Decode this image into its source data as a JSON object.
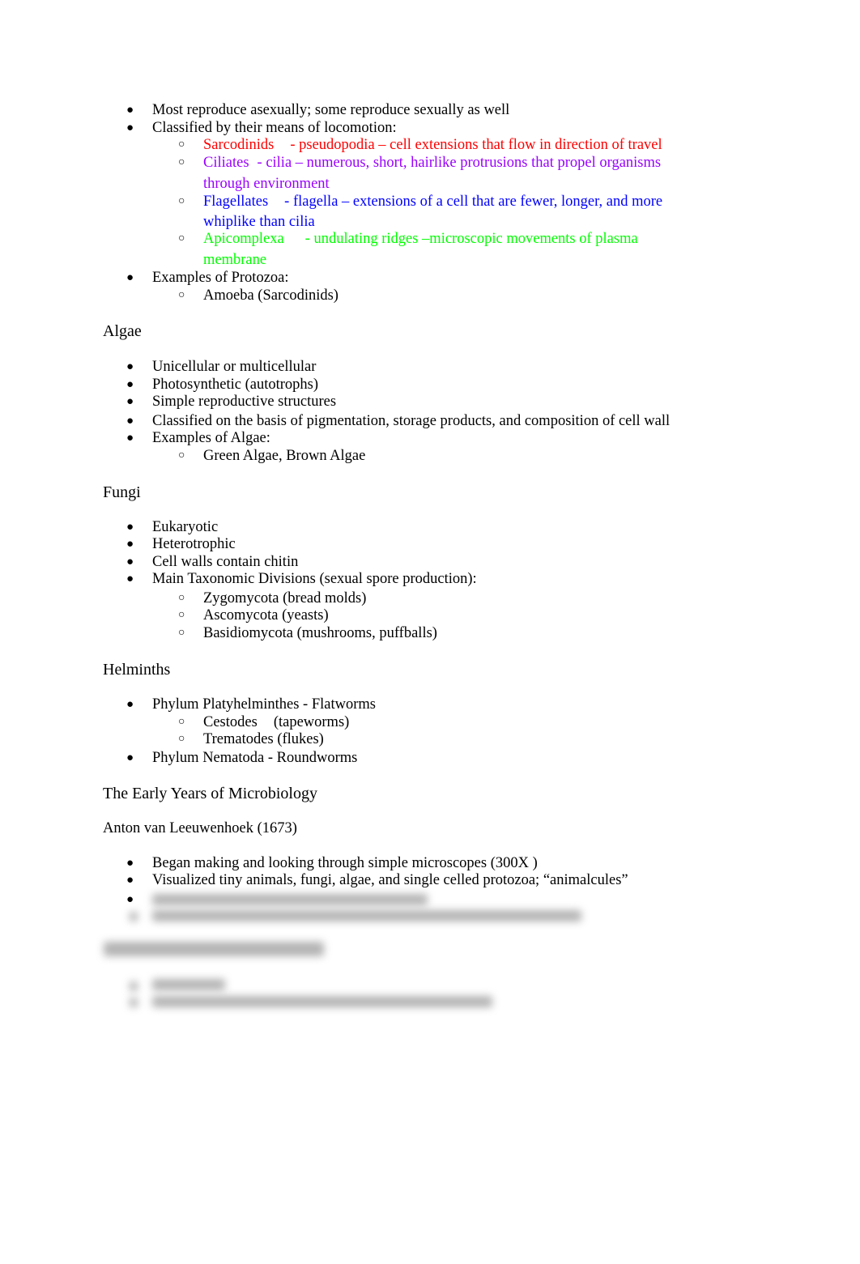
{
  "protozoa": {
    "bullets": [
      "Most reproduce asexually; some reproduce sexually as well",
      "Classified by their means of locomotion:"
    ],
    "locomotion": [
      {
        "name": "Sarcodinids",
        "desc_line1": "- pseudopodia – cell extensions that flow in direction of travel",
        "desc_line2": "",
        "color": "#ff0000"
      },
      {
        "name": "Ciliates",
        "desc_line1": "- cilia – numerous, short, hairlike protrusions that propel organisms",
        "desc_line2": "through environment",
        "color": "#9900ff"
      },
      {
        "name": "Flagellates",
        "desc_line1": "- flagella – extensions of a cell that are fewer, longer, and more",
        "desc_line2": "whiplike than cilia",
        "color": "#0000ff"
      },
      {
        "name": "Apicomplexa",
        "desc_line1": "- undulating ridges –microscopic movements of plasma",
        "desc_line2": "membrane",
        "color": "#00ff00"
      }
    ],
    "examples_label": "Examples of Protozoa:",
    "examples": [
      "Amoeba (Sarcodinids)"
    ]
  },
  "algae": {
    "heading": "Algae",
    "bullets": [
      "Unicellular or multicellular",
      "Photosynthetic (autotrophs)",
      "Simple reproductive structures",
      "Classified on the basis of pigmentation, storage products, and composition of cell wall",
      "Examples of Algae:"
    ],
    "examples": [
      "Green Algae, Brown Algae"
    ]
  },
  "fungi": {
    "heading": "Fungi",
    "bullets": [
      "Eukaryotic",
      "Heterotrophic",
      "Cell walls contain chitin",
      "Main Taxonomic Divisions (sexual spore production):"
    ],
    "divisions": [
      "Zygomycota (bread molds)",
      "Ascomycota (yeasts)",
      "Basidiomycota (mushrooms, puffballs)"
    ]
  },
  "helminths": {
    "heading": "Helminths",
    "platyhelminthes": "Phylum Platyhelminthes - Flatworms",
    "flatworm_types": [
      {
        "name": "Cestodes",
        "note": "(tapeworms)"
      },
      {
        "name": "Trematodes",
        "note": "(flukes)"
      }
    ],
    "nematoda": "Phylum Nematoda - Roundworms"
  },
  "early_years": {
    "heading": "The Early Years of Microbiology",
    "subheading": "Anton van Leeuwenhoek (1673)",
    "bullets": [
      "Began making and looking through simple microscopes (300X )",
      "Visualized tiny animals, fungi, algae, and single celled protozoa; “animalcules”"
    ]
  }
}
